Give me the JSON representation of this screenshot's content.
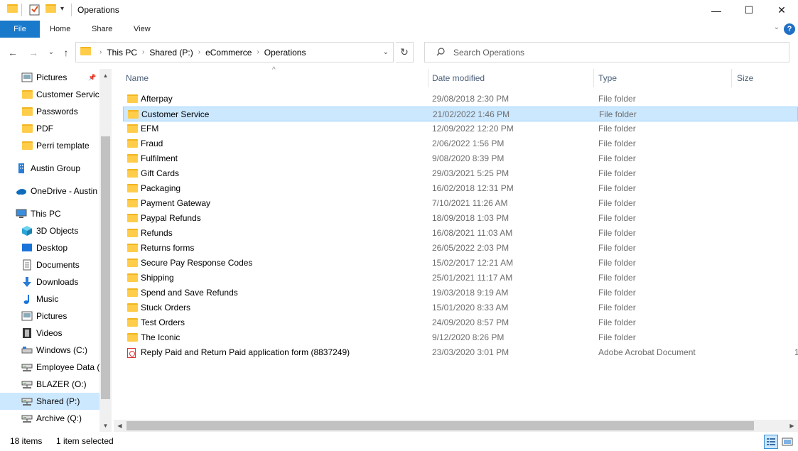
{
  "window": {
    "title": "Operations",
    "minimize": "—",
    "maximize": "☐",
    "close": "✕"
  },
  "ribbon": {
    "tabs": [
      "File",
      "Home",
      "Share",
      "View"
    ],
    "help": "?",
    "collapse": "⌄"
  },
  "nav": {
    "back": "←",
    "forward": "→",
    "recent": "⌄",
    "up": "↑"
  },
  "address": {
    "crumbs": [
      "This PC",
      "Shared (P:)",
      "eCommerce",
      "Operations"
    ],
    "separator": "›",
    "dropdown": "⌄",
    "refresh": "↻"
  },
  "search": {
    "placeholder": "Search Operations",
    "value": ""
  },
  "sidebar": {
    "items": [
      {
        "label": "Pictures",
        "icon": "pictures-icon",
        "pinned": true
      },
      {
        "label": "Customer Servic",
        "icon": "folder-icon"
      },
      {
        "label": "Passwords",
        "icon": "folder-icon"
      },
      {
        "label": "PDF",
        "icon": "folder-icon"
      },
      {
        "label": "Perri template",
        "icon": "folder-icon"
      },
      {
        "label": "Austin Group",
        "icon": "building-icon"
      },
      {
        "label": "OneDrive - Austin",
        "icon": "cloud-icon"
      },
      {
        "label": "This PC",
        "icon": "computer-icon"
      },
      {
        "label": "3D Objects",
        "icon": "cube-icon"
      },
      {
        "label": "Desktop",
        "icon": "desktop-icon"
      },
      {
        "label": "Documents",
        "icon": "documents-icon"
      },
      {
        "label": "Downloads",
        "icon": "download-icon"
      },
      {
        "label": "Music",
        "icon": "music-icon"
      },
      {
        "label": "Pictures",
        "icon": "pictures-icon"
      },
      {
        "label": "Videos",
        "icon": "video-icon"
      },
      {
        "label": "Windows (C:)",
        "icon": "drive-icon"
      },
      {
        "label": "Employee Data (",
        "icon": "network-drive-icon"
      },
      {
        "label": "BLAZER (O:)",
        "icon": "network-drive-icon"
      },
      {
        "label": "Shared (P:)",
        "icon": "network-drive-icon",
        "selected": true
      },
      {
        "label": "Archive (Q:)",
        "icon": "network-drive-icon"
      }
    ]
  },
  "columns": {
    "name": "Name",
    "date": "Date modified",
    "type": "Type",
    "size": "Size"
  },
  "files": [
    {
      "name": "Afterpay",
      "date": "29/08/2018 2:30 PM",
      "type": "File folder",
      "size": "",
      "kind": "folder"
    },
    {
      "name": "Customer Service",
      "date": "21/02/2022 1:46 PM",
      "type": "File folder",
      "size": "",
      "kind": "folder",
      "selected": true
    },
    {
      "name": "EFM",
      "date": "12/09/2022 12:20 PM",
      "type": "File folder",
      "size": "",
      "kind": "folder"
    },
    {
      "name": "Fraud",
      "date": "2/06/2022 1:56 PM",
      "type": "File folder",
      "size": "",
      "kind": "folder"
    },
    {
      "name": "Fulfilment",
      "date": "9/08/2020 8:39 PM",
      "type": "File folder",
      "size": "",
      "kind": "folder"
    },
    {
      "name": "Gift Cards",
      "date": "29/03/2021 5:25 PM",
      "type": "File folder",
      "size": "",
      "kind": "folder"
    },
    {
      "name": "Packaging",
      "date": "16/02/2018 12:31 PM",
      "type": "File folder",
      "size": "",
      "kind": "folder"
    },
    {
      "name": "Payment Gateway",
      "date": "7/10/2021 11:26 AM",
      "type": "File folder",
      "size": "",
      "kind": "folder"
    },
    {
      "name": "Paypal Refunds",
      "date": "18/09/2018 1:03 PM",
      "type": "File folder",
      "size": "",
      "kind": "folder"
    },
    {
      "name": "Refunds",
      "date": "16/08/2021 11:03 AM",
      "type": "File folder",
      "size": "",
      "kind": "folder"
    },
    {
      "name": "Returns forms",
      "date": "26/05/2022 2:03 PM",
      "type": "File folder",
      "size": "",
      "kind": "folder"
    },
    {
      "name": "Secure Pay Response Codes",
      "date": "15/02/2017 12:21 AM",
      "type": "File folder",
      "size": "",
      "kind": "folder"
    },
    {
      "name": "Shipping",
      "date": "25/01/2021 11:17 AM",
      "type": "File folder",
      "size": "",
      "kind": "folder"
    },
    {
      "name": "Spend and Save Refunds",
      "date": "19/03/2018 9:19 AM",
      "type": "File folder",
      "size": "",
      "kind": "folder"
    },
    {
      "name": "Stuck Orders",
      "date": "15/01/2020 8:33 AM",
      "type": "File folder",
      "size": "",
      "kind": "folder"
    },
    {
      "name": "Test Orders",
      "date": "24/09/2020 8:57 PM",
      "type": "File folder",
      "size": "",
      "kind": "folder"
    },
    {
      "name": "The Iconic",
      "date": "9/12/2020 8:26 PM",
      "type": "File folder",
      "size": "",
      "kind": "folder"
    },
    {
      "name": "Reply Paid and Return Paid application form (8837249)",
      "date": "23/03/2020 3:01 PM",
      "type": "Adobe Acrobat Document",
      "size": "1",
      "kind": "pdf"
    }
  ],
  "status": {
    "count": "18 items",
    "selected": "1 item selected"
  },
  "colors": {
    "accent": "#1979ca",
    "selection": "#cce8ff",
    "selection_border": "#99d1ff",
    "folder": "#ffcd4a"
  }
}
